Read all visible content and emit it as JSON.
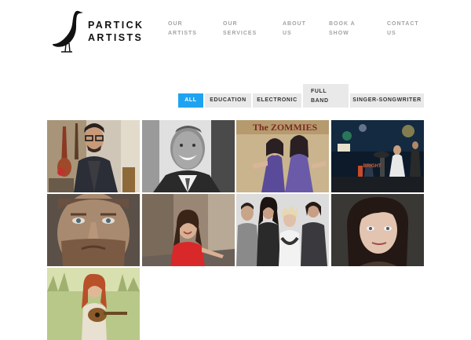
{
  "logo": {
    "line1": "PARTICK",
    "line2": "ARTISTS",
    "icon": "heron-icon"
  },
  "nav": [
    {
      "line1": "OUR",
      "line2": "ARTISTS"
    },
    {
      "line1": "OUR",
      "line2": "SERVICES"
    },
    {
      "line1": "ABOUT",
      "line2": "US"
    },
    {
      "line1": "BOOK A",
      "line2": "SHOW"
    },
    {
      "line1": "CONTACT",
      "line2": "US"
    }
  ],
  "filters": {
    "all": "ALL",
    "education": "EDUCATION",
    "electronic": "ELECTRONIC",
    "full_band_line1": "FULL",
    "full_band_line2": "BAND",
    "singer_songwriter": "SINGER-SONGWRITER",
    "active": "ALL"
  },
  "colors": {
    "accent": "#1fa3f0",
    "filter_bg": "#e9e9e9",
    "nav_text": "#a3a3a3"
  },
  "artist_tiles": [
    {
      "photo": "man-with-glasses-guitars-photo"
    },
    {
      "photo": "smiling-man-bw-photo"
    },
    {
      "photo": "band-poster-photo",
      "poster_text": "The ZOMMIES"
    },
    {
      "photo": "band-on-stage-photo"
    },
    {
      "photo": "bearded-man-closeup-photo"
    },
    {
      "photo": "woman-red-dress-photo"
    },
    {
      "photo": "four-piece-band-photo"
    },
    {
      "photo": "dark-haired-woman-photo"
    },
    {
      "photo": "girl-with-guitar-field-photo"
    }
  ]
}
